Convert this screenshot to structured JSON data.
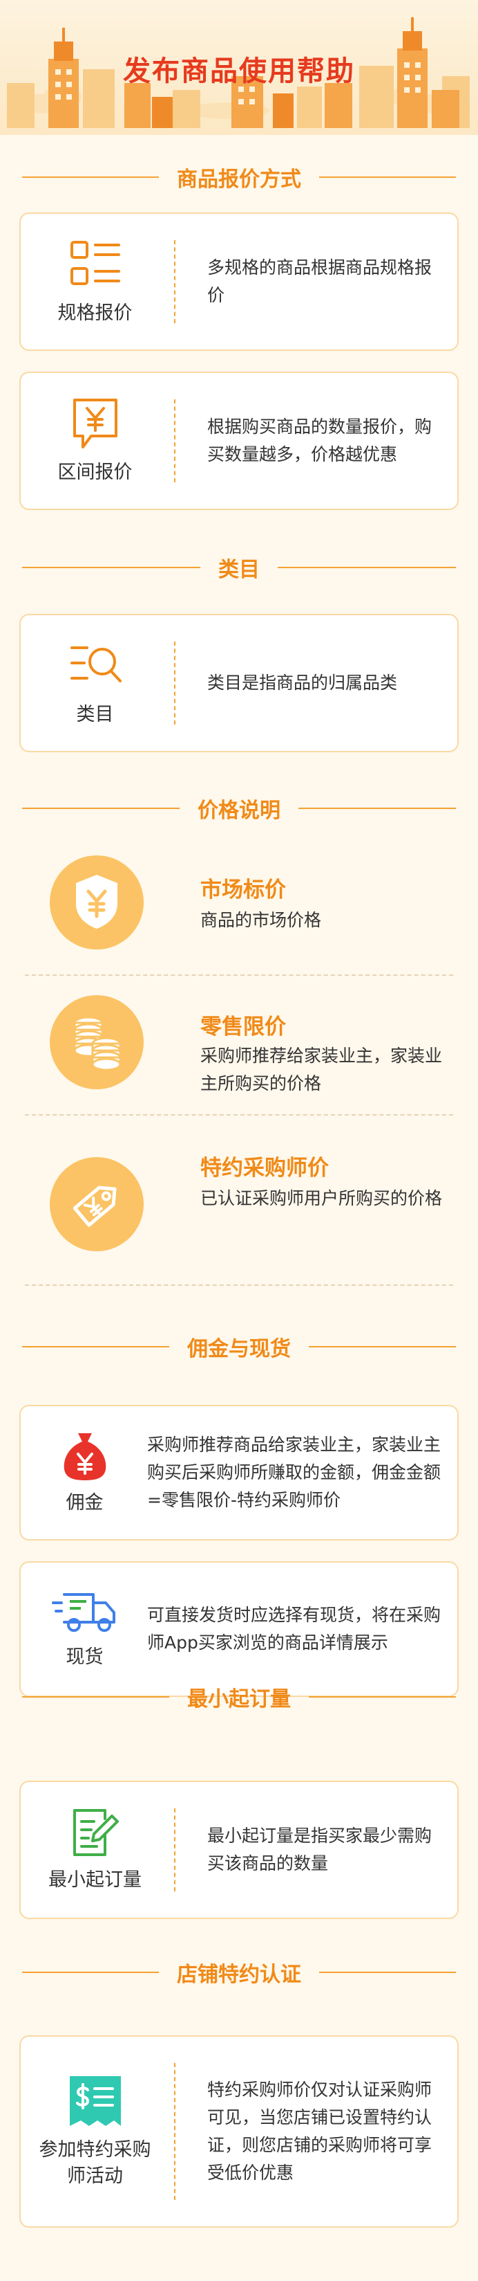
{
  "page": {
    "title": "发布商品使用帮助"
  },
  "sections": {
    "pricing": {
      "title": "商品报价方式",
      "cards": [
        {
          "icon": "list-icon",
          "label": "规格报价",
          "desc": "多规格的商品根据商品规格报价"
        },
        {
          "icon": "yuan-bubble-icon",
          "label": "区间报价",
          "desc": "根据购买商品的数量报价，购买数量越多，价格越优惠"
        }
      ]
    },
    "category": {
      "title": "类目",
      "cards": [
        {
          "icon": "search-list-icon",
          "label": "类目",
          "desc": "类目是指商品的归属品类"
        }
      ]
    },
    "price_info": {
      "title": "价格说明",
      "items": [
        {
          "icon": "shield-yuan-icon",
          "title": "市场标价",
          "desc": "商品的市场价格"
        },
        {
          "icon": "coins-icon",
          "title": "零售限价",
          "desc": "采购师推荐给家装业主，家装业主所购买的价格"
        },
        {
          "icon": "price-tag-icon",
          "title": "特约采购师价",
          "desc": "已认证采购师用户所购买的价格"
        }
      ]
    },
    "commission": {
      "title": "佣金与现货",
      "cards": [
        {
          "icon": "money-bag-icon",
          "label": "佣金",
          "desc": "采购师推荐商品给家装业主，家装业主购买后采购师所赚取的金额，佣金金额=零售限价-特约采购师价"
        },
        {
          "icon": "delivery-truck-icon",
          "label": "现货",
          "desc": "可直接发货时应选择有现货，将在采购师App买家浏览的商品详情展示"
        }
      ]
    },
    "min_order": {
      "title": "最小起订量",
      "cards": [
        {
          "icon": "order-form-icon",
          "label": "最小起订量",
          "desc": "最小起订量是指买家最少需购买该商品的数量"
        }
      ]
    },
    "store": {
      "title": "店铺特约认证",
      "cards": [
        {
          "icon": "dollar-receipt-icon",
          "label": "参加特约采购师活动",
          "desc": "特约采购师价仅对认证采购师可见，当您店铺已设置特约认证，则您店铺的采购师将可享受低价优惠"
        }
      ]
    }
  },
  "colors": {
    "accent": "#f08a18",
    "title_red": "#e63a1e",
    "card_border": "#f9d9a4",
    "icon_circle": "#fbc365",
    "money_bag_red": "#e8332a",
    "teal": "#2fc9b1",
    "blue": "#3f7fe8",
    "green": "#3fae48"
  }
}
